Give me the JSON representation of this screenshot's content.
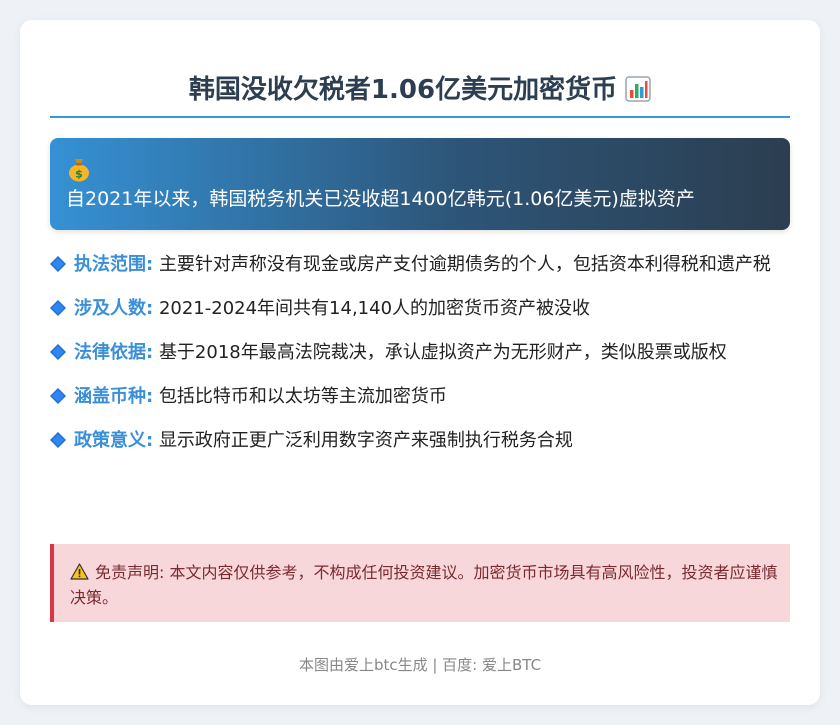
{
  "header": {
    "title": "韩国没收欠税者1.06亿美元加密货币",
    "title_icon": "bar-chart-icon"
  },
  "banner": {
    "icon": "money-bag-icon",
    "text": "自2021年以来，韩国税务机关已没收超1400亿韩元(1.06亿美元)虚拟资产"
  },
  "points": [
    {
      "label": "执法范围:",
      "text": "主要针对声称没有现金或房产支付逾期债务的个人，包括资本利得税和遗产税"
    },
    {
      "label": "涉及人数:",
      "text": "2021-2024年间共有14,140人的加密货币资产被没收"
    },
    {
      "label": "法律依据:",
      "text": "基于2018年最高法院裁决，承认虚拟资产为无形财产，类似股票或版权"
    },
    {
      "label": "涵盖币种:",
      "text": "包括比特币和以太坊等主流加密货币"
    },
    {
      "label": "政策意义:",
      "text": "显示政府正更广泛利用数字资产来强制执行税务合规"
    }
  ],
  "disclaimer": {
    "icon": "warning-icon",
    "text": "免责声明: 本文内容仅供参考，不构成任何投资建议。加密货币市场具有高风险性，投资者应谨慎决策。"
  },
  "footer": {
    "text": "本图由爱上btc生成 | 百度: 爱上BTC"
  },
  "colors": {
    "accent": "#3498db",
    "label": "#3a8fd8",
    "title": "#2c3e50",
    "banner_start": "#3591d5",
    "banner_end": "#2c3e50",
    "disclaimer_bg": "#f8d7da",
    "disclaimer_border": "#dc3545"
  }
}
